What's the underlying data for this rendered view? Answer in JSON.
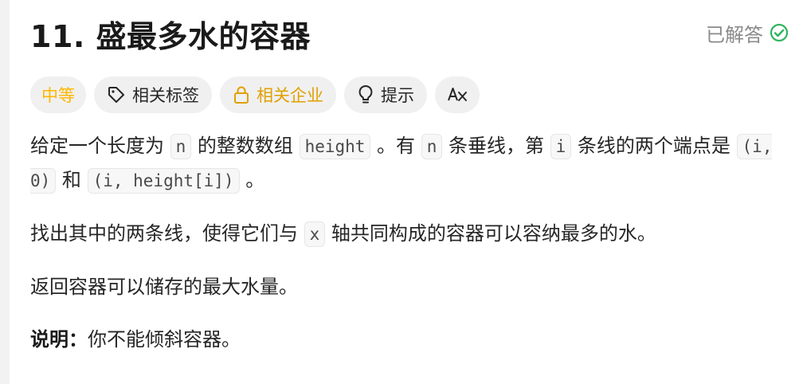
{
  "problem": {
    "title": "11. 盛最多水的容器",
    "status": "已解答"
  },
  "tags": {
    "difficulty": "中等",
    "topics": "相关标签",
    "companies": "相关企业",
    "hints": "提示",
    "translate_icon_text": "Aあ"
  },
  "description": {
    "p1": {
      "t1": "给定一个长度为 ",
      "c1": "n",
      "t2": " 的整数数组 ",
      "c2": "height",
      "t3": " 。有 ",
      "c3": "n",
      "t4": " 条垂线，第 ",
      "c4": "i",
      "t5": " 条线的两个端点是 ",
      "c5": "(i, 0)",
      "t6": " 和 ",
      "c6": "(i, height[i])",
      "t7": " 。"
    },
    "p2": {
      "t1": "找出其中的两条线，使得它们与 ",
      "c1": "x",
      "t2": " 轴共同构成的容器可以容纳最多的水。"
    },
    "p3": "返回容器可以储存的最大水量。",
    "p4": {
      "label": "说明：",
      "text": "你不能倾斜容器。"
    }
  },
  "colors": {
    "difficulty_medium": "#ffb700",
    "solved_check": "#2db55d"
  }
}
